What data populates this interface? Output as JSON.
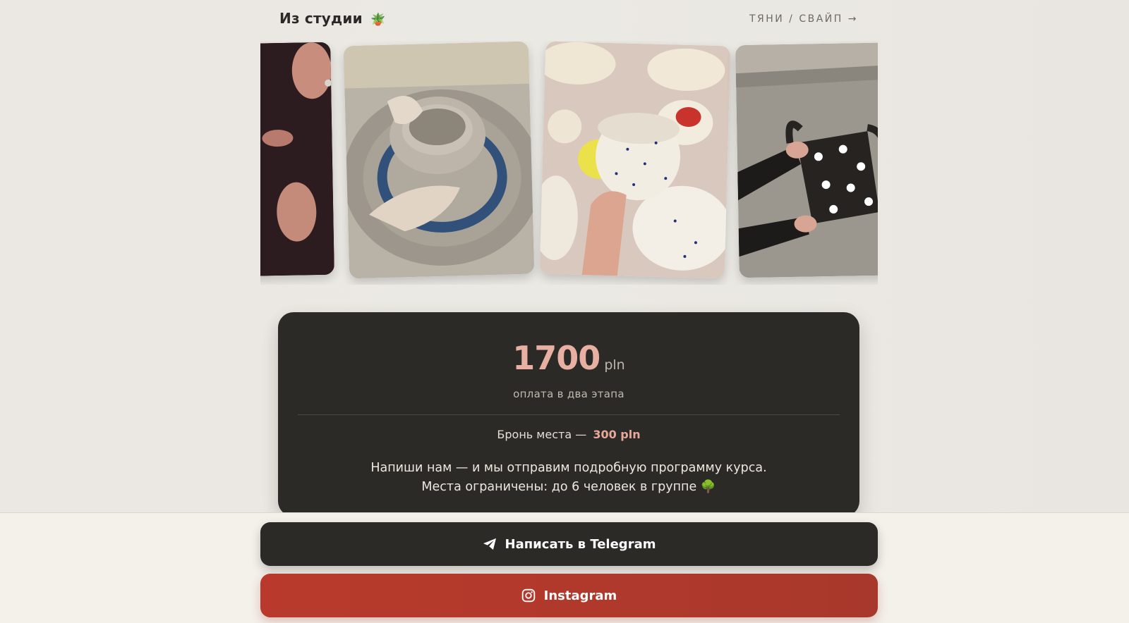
{
  "header": {
    "title": "Из студии",
    "title_emoji": "🪴",
    "swipe_hint": "ТЯНИ / СВАЙП →"
  },
  "gallery": {
    "images": [
      {
        "name": "photo-dark-sweater",
        "description_icon": "photo-icon"
      },
      {
        "name": "photo-pottery-wheel",
        "description_icon": "photo-icon"
      },
      {
        "name": "photo-speckled-ceramics",
        "description_icon": "photo-icon"
      },
      {
        "name": "photo-polka-dot-vase",
        "description_icon": "photo-icon"
      }
    ]
  },
  "price": {
    "amount": "1700",
    "currency": "pln",
    "note": "оплата в два этапа",
    "deposit_label": "Бронь места —",
    "deposit_value": "300 pln",
    "description_line1": "Напиши нам — и мы отправим подробную программу курса.",
    "description_line2": "Места ограничены: до 6 человек в группе 🌳"
  },
  "actions": {
    "telegram_label": "Написать в Telegram",
    "instagram_label": "Instagram"
  },
  "colors": {
    "accent": "#e8b0a3",
    "card_bg": "#2b2a27",
    "instagram_bg": "#b93a2c"
  }
}
